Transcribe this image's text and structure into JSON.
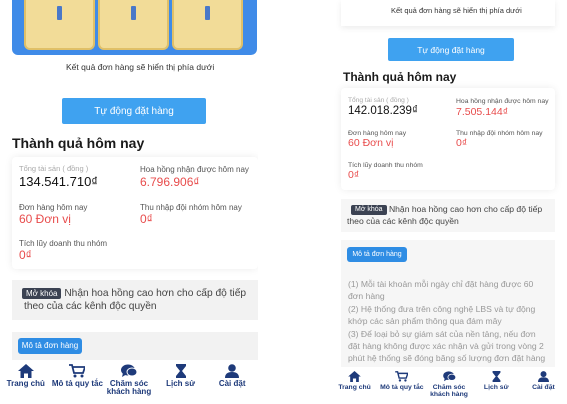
{
  "left": {
    "result_note": "Kết quả đơn hàng sẽ hiển thị phía dưới",
    "auto_order_label": "Tự động đặt hàng",
    "section_title": "Thành quả hôm nay",
    "total_assets_label": "Tổng tài sản ( đồng )",
    "total_assets_value": "134.541.710₫",
    "commission_label": "Hoa hồng nhận được hôm nay",
    "commission_value": "6.796.906₫",
    "orders_label": "Đơn hàng hôm nay",
    "orders_value": "60 Đơn vị",
    "team_income_label": "Thu nhập đội nhóm hôm nay",
    "team_income_value": "0₫",
    "team_revenue_label": "Tích lũy doanh thu nhóm",
    "team_revenue_value": "0₫",
    "unlock_badge": "Mở khóa",
    "unlock_text_1": "Nhận hoa hồng cao hơn cho cấp độ tiếp",
    "unlock_text_2": "theo của các kênh độc quyền",
    "order_desc_label": "Mô tả đơn hàng"
  },
  "right": {
    "result_note": "Kết quả đơn hàng sẽ hiển thị phía dưới",
    "auto_order_label": "Tự động đặt hàng",
    "section_title": "Thành quả hôm nay",
    "total_assets_label": "Tổng tài sản ( đồng )",
    "total_assets_value": "142.018.239₫",
    "commission_label": "Hoa hồng nhận được hôm nay",
    "commission_value": "7.505.144₫",
    "orders_label": "Đơn hàng hôm nay",
    "orders_value": "60 Đơn vị",
    "team_income_label": "Thu nhập đội nhóm hôm nay",
    "team_income_value": "0₫",
    "team_revenue_label": "Tích lũy doanh thu nhóm",
    "team_revenue_value": "0₫",
    "unlock_badge": "Mở khóa",
    "unlock_text_1": "Nhận hoa hồng cao hơn cho cấp độ tiếp",
    "unlock_text_2": "theo của các kênh độc quyền",
    "order_desc_label": "Mô tả đơn hàng",
    "rules": [
      "(1) Mỗi tài khoản mỗi ngày chỉ đặt hàng được 60",
      "đơn hàng",
      "(2) Hệ thống đưa trên công nghệ LBS và tự động",
      "khớp các sản phẩm thông qua đám mây",
      "(3) Để loại bỏ sự giám sát của nền tảng, nếu đơn",
      "đặt hàng không được xác nhận và gửi trong vòng 2",
      "phút hệ thống sẽ đóng băng số lượng đơn đặt hàng"
    ]
  },
  "nav": {
    "home": "Trang chủ",
    "rules_line1": "Mô tả quy tắc",
    "support_line1": "Chăm sóc",
    "support_line2": "khách hàng",
    "history": "Lịch sử",
    "settings": "Cài đặt"
  },
  "colors": {
    "accent_blue": "#3fa2f0",
    "nav_navy": "#1e3a7a",
    "value_red": "#e84c4c"
  },
  "icons": [
    "home-icon",
    "cart-icon",
    "chat-icon",
    "hourglass-icon",
    "user-icon"
  ]
}
